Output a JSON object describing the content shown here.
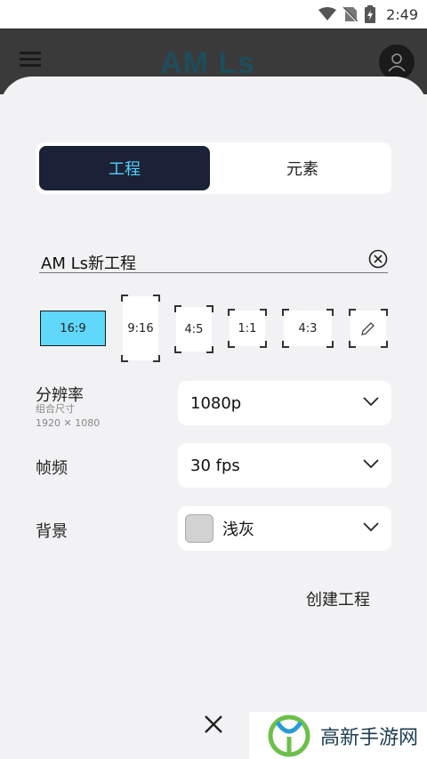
{
  "status_bar": {
    "time": "2:49",
    "icons": [
      "wifi-icon",
      "no-sim-icon",
      "battery-icon"
    ]
  },
  "header": {
    "logo_text": "AM Ls",
    "menu_icon": "hamburger-menu-icon",
    "avatar_icon": "user-avatar-icon"
  },
  "tabs": {
    "active": "工程",
    "inactive": "元素"
  },
  "project_name": {
    "value": "AM Ls新工程"
  },
  "ratios": [
    "16:9",
    "9:16",
    "4:5",
    "1:1",
    "4:3"
  ],
  "ratio_selected": "16:9",
  "settings": {
    "resolution": {
      "label": "分辨率",
      "sub1": "组合尺寸",
      "sub2": "1920 ✕ 1080",
      "value": "1080p"
    },
    "framerate": {
      "label": "帧频",
      "value": "30 fps"
    },
    "background": {
      "label": "背景",
      "value": "浅灰",
      "swatch_color": "#d2d2d2"
    }
  },
  "actions": {
    "create": "创建工程"
  },
  "watermark": {
    "text": "高新手游网"
  },
  "colors": {
    "accent": "#53d0f5",
    "tab_active_bg": "#1b2238",
    "ratio_selected_bg": "#5fd8fb"
  }
}
